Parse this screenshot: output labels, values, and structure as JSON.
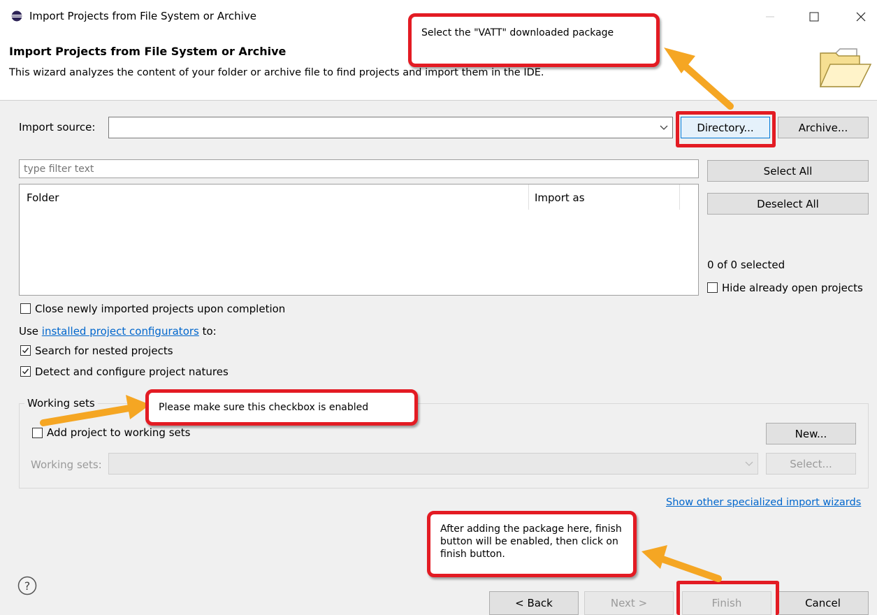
{
  "window": {
    "title": "Import Projects from File System or Archive"
  },
  "banner": {
    "title": "Import Projects from File System or Archive",
    "description": "This wizard analyzes the content of your folder or archive file to find projects and import them in the IDE."
  },
  "import_source": {
    "label": "Import source:",
    "value": "",
    "directory_button": "Directory...",
    "archive_button": "Archive..."
  },
  "filter": {
    "placeholder": "type filter text"
  },
  "table": {
    "columns": [
      "Folder",
      "Import as"
    ],
    "rows": []
  },
  "selection": {
    "select_all": "Select All",
    "deselect_all": "Deselect All",
    "count_text": "0 of 0 selected",
    "hide_open_label": "Hide already open projects",
    "hide_open_checked": false
  },
  "options": {
    "close_imported_label": "Close newly imported projects upon completion",
    "close_imported_checked": false,
    "use_prefix": "Use ",
    "configurators_link": "installed project configurators",
    "use_suffix": " to:",
    "search_nested_label": "Search for nested projects",
    "search_nested_checked": true,
    "detect_natures_label": "Detect and configure project natures",
    "detect_natures_checked": true
  },
  "working_sets": {
    "group_label": "Working sets",
    "add_label": "Add project to working sets",
    "add_checked": false,
    "new_button": "New...",
    "field_label": "Working sets:",
    "select_button": "Select..."
  },
  "specialized_link": "Show other specialized import wizards",
  "footer": {
    "back": "< Back",
    "next": "Next >",
    "finish": "Finish",
    "cancel": "Cancel"
  },
  "callouts": {
    "directory": "Select the \"VATT\" downloaded package",
    "checkbox": "Please make sure this checkbox is enabled",
    "finish": "After adding the package here, finish button will be enabled, then click on finish button."
  },
  "colors": {
    "accent_red": "#e31b23",
    "arrow_orange": "#f5a623",
    "link_blue": "#0066cc",
    "dialog_bg": "#f0f0f0"
  }
}
